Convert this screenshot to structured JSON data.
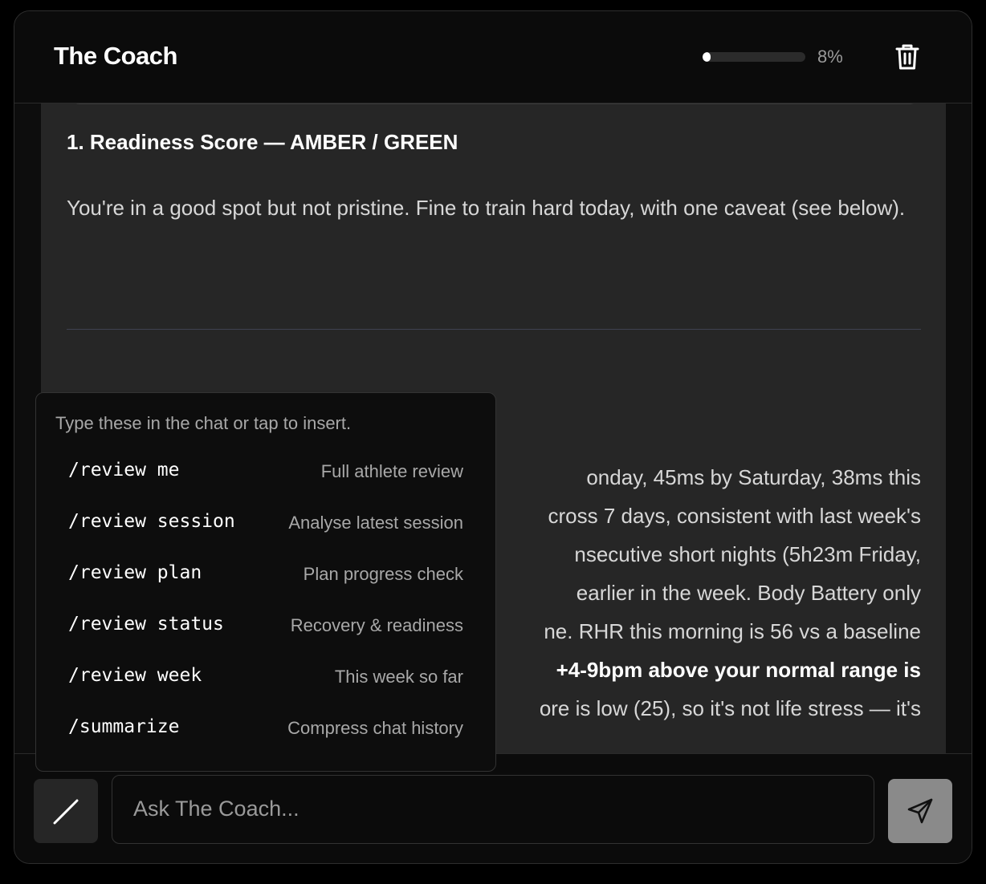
{
  "header": {
    "title": "The Coach",
    "progress_percent": 8,
    "progress_label": "8%",
    "delete_icon": "trash-icon"
  },
  "message": {
    "heading": "1. Readiness Score — AMBER / GREEN",
    "paragraph": "You're in a good spot but not pristine. Fine to train hard today, with one caveat (see below).",
    "partial_lines": [
      {
        "text": "onday, 45ms by Saturday, 38ms this",
        "bold": false
      },
      {
        "text": "cross 7 days, consistent with last week's",
        "bold": false
      },
      {
        "text": "nsecutive short nights (5h23m Friday,",
        "bold": false
      },
      {
        "text": "earlier in the week. Body Battery only",
        "bold": false
      },
      {
        "text": "ne. RHR this morning is 56 vs a baseline",
        "bold": false
      },
      {
        "text": "+4-9bpm above your normal range is",
        "bold": true
      },
      {
        "text": "ore is low (25), so it's not life stress — it's",
        "bold": false
      }
    ]
  },
  "commands_popup": {
    "hint": "Type these in the chat or tap to insert.",
    "items": [
      {
        "command": "/review me",
        "description": "Full athlete review"
      },
      {
        "command": "/review session",
        "description": "Analyse latest session"
      },
      {
        "command": "/review plan",
        "description": "Plan progress check"
      },
      {
        "command": "/review status",
        "description": "Recovery & readiness"
      },
      {
        "command": "/review week",
        "description": "This week so far"
      },
      {
        "command": "/summarize",
        "description": "Compress chat history"
      }
    ]
  },
  "composer": {
    "slash_icon": "slash-icon",
    "placeholder": "Ask The Coach...",
    "send_icon": "send-icon"
  },
  "colors": {
    "background": "#000000",
    "panel": "#0d0d0d",
    "message_bg": "#262626",
    "accent": "#ffffff",
    "send_button": "#8a8a8a"
  }
}
